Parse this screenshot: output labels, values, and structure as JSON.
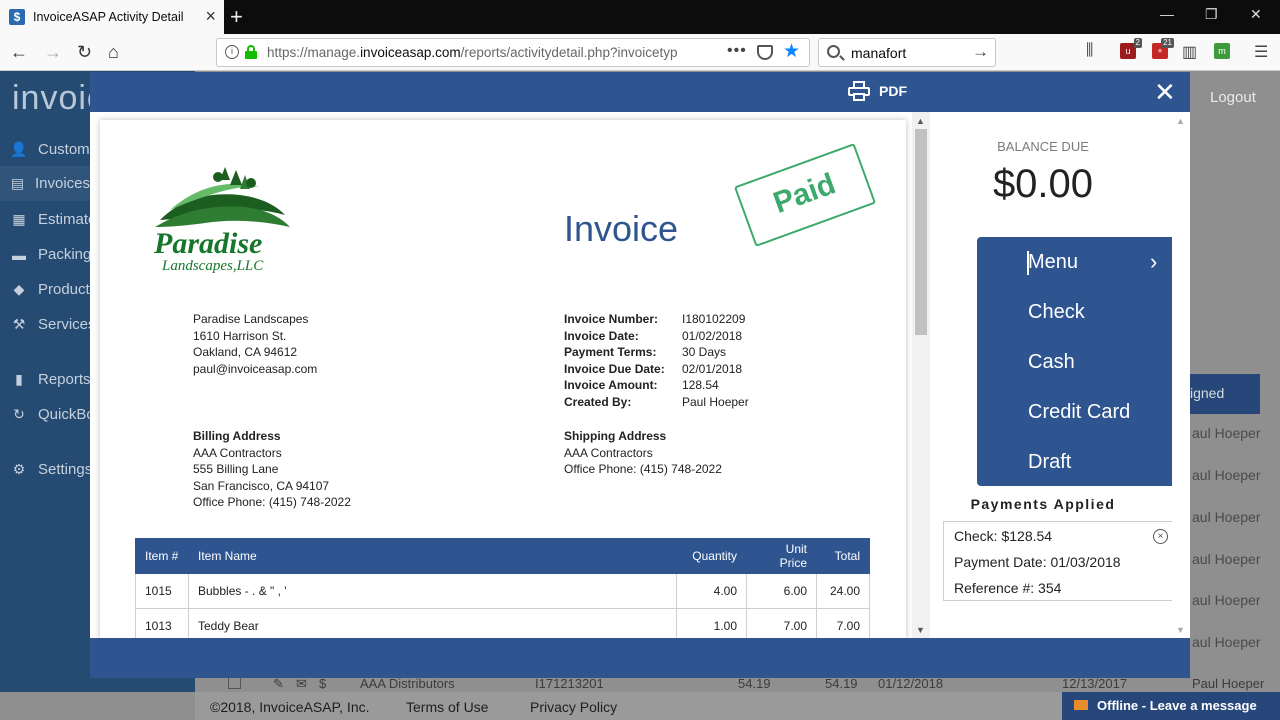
{
  "browser": {
    "tab_title": "InvoiceASAP Activity Detail",
    "url_prefix": "https://manage.",
    "url_domain": "invoiceasap.com",
    "url_path": "/reports/activitydetail.php?invoicetyp",
    "search_value": "manafort",
    "ext_badge_1": "2",
    "ext_badge_2": "21"
  },
  "app": {
    "logo": "invoic",
    "logout": "Logout",
    "sidebar": [
      {
        "label": "Customers",
        "icon": "person-icon"
      },
      {
        "label": "Invoices",
        "icon": "document-icon"
      },
      {
        "label": "Estimates",
        "icon": "grid-icon"
      },
      {
        "label": "Packing",
        "icon": "truck-icon"
      },
      {
        "label": "Products",
        "icon": "box-icon"
      },
      {
        "label": "Services",
        "icon": "wrench-icon"
      },
      {
        "label": "Reports",
        "icon": "bar-chart-icon"
      },
      {
        "label": "QuickBo",
        "icon": "sync-icon"
      },
      {
        "label": "Settings",
        "icon": "gear-icon"
      }
    ],
    "bg_status": "igned",
    "bg_names": [
      "aul Hoeper",
      "aul Hoeper",
      "aul Hoeper",
      "aul Hoeper",
      "aul Hoeper",
      "aul Hoeper",
      "Paul Hoeper"
    ],
    "bg_row": {
      "customer": "AAA Distributors",
      "number": "I171213201",
      "amount": "54.19",
      "balance": "54.19",
      "date": "01/12/2018",
      "due": "12/13/2017"
    },
    "footer": {
      "copyright": "©2018, InvoiceASAP, Inc.",
      "terms": "Terms of Use",
      "privacy": "Privacy Policy"
    },
    "offline": "Offline - Leave a message"
  },
  "modal": {
    "pdf_label": "PDF",
    "invoice": {
      "logo_name": "Paradise",
      "logo_sub": "Landscapes,LLC",
      "title": "Invoice",
      "stamp": "Paid",
      "from": [
        "Paradise Landscapes",
        "1610 Harrison St.",
        "Oakland, CA 94612",
        "paul@invoiceasap.com"
      ],
      "meta": [
        {
          "label": "Invoice Number:",
          "value": "I180102209"
        },
        {
          "label": "Invoice Date:",
          "value": "01/02/2018"
        },
        {
          "label": "Payment Terms:",
          "value": "30 Days"
        },
        {
          "label": "Invoice Due Date:",
          "value": "02/01/2018"
        },
        {
          "label": "Invoice Amount:",
          "value": "128.54"
        },
        {
          "label": "Created By:",
          "value": "Paul Hoeper"
        }
      ],
      "billing": {
        "title": "Billing Address",
        "lines": [
          "AAA Contractors",
          "555 Billing Lane",
          "San Francisco, CA 94107",
          "Office Phone: (415) 748-2022"
        ]
      },
      "shipping": {
        "title": "Shipping Address",
        "lines": [
          "AAA Contractors",
          "Office Phone: (415) 748-2022"
        ]
      },
      "table": {
        "headers": [
          "Item #",
          "Item Name",
          "Quantity",
          "Unit Price",
          "Total"
        ],
        "rows": [
          [
            "1015",
            "Bubbles - . & \" , '",
            "4.00",
            "6.00",
            "24.00"
          ],
          [
            "1013",
            "Teddy Bear",
            "1.00",
            "7.00",
            "7.00"
          ]
        ]
      }
    },
    "panel": {
      "balance_label": "BALANCE DUE",
      "balance_value": "$0.00",
      "menu": [
        "Menu",
        "Check",
        "Cash",
        "Credit Card",
        "Draft"
      ],
      "payments_title": "Payments Applied",
      "payment": {
        "check": "Check: $128.54",
        "date": "Payment Date: 01/03/2018",
        "ref": "Reference #: 354"
      }
    }
  }
}
